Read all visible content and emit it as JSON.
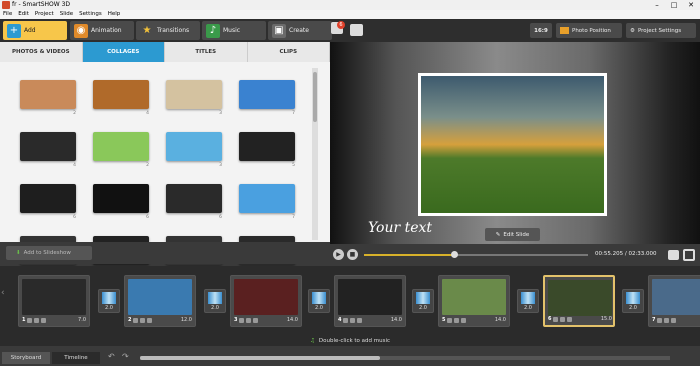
{
  "window": {
    "title": "fr - SmartSHOW 3D"
  },
  "menu": [
    "File",
    "Edit",
    "Project",
    "Slide",
    "Settings",
    "Help"
  ],
  "main_tabs": [
    {
      "label": "Add",
      "icon": "plus-icon"
    },
    {
      "label": "Animation",
      "icon": "animation-icon"
    },
    {
      "label": "Transitions",
      "icon": "star-icon"
    },
    {
      "label": "Music",
      "icon": "music-icon"
    },
    {
      "label": "Create",
      "icon": "film-icon"
    }
  ],
  "notification_count": "6",
  "toolbar": {
    "aspect": "16:9",
    "photo_position": "Photo Position",
    "project_settings": "Project Settings"
  },
  "sub_tabs": [
    "PHOTOS & VIDEOS",
    "COLLAGES",
    "TITLES",
    "CLIPS"
  ],
  "collages": [
    {
      "count": "2",
      "color": "#c98a5a"
    },
    {
      "count": "4",
      "color": "#b06a2a"
    },
    {
      "count": "3",
      "color": "#d4c2a0"
    },
    {
      "count": "7",
      "color": "#3a82d0"
    },
    {
      "count": "4",
      "color": "#2a2a2a"
    },
    {
      "count": "2",
      "color": "#8ac85a"
    },
    {
      "count": "3",
      "color": "#5ab0e0"
    },
    {
      "count": "5",
      "color": "#222222"
    },
    {
      "count": "6",
      "color": "#1e1e1e"
    },
    {
      "count": "6",
      "color": "#111111"
    },
    {
      "count": "6",
      "color": "#2a2a2a"
    },
    {
      "count": "7",
      "color": "#4aa0e0"
    },
    {
      "count": "",
      "color": "#333333"
    },
    {
      "count": "",
      "color": "#222222"
    },
    {
      "count": "",
      "color": "#333333"
    },
    {
      "count": "",
      "color": "#2a2a2a"
    }
  ],
  "add_to_slideshow": "Add to Slideshow",
  "preview": {
    "overlay_text": "Your text",
    "edit_slide": "Edit Slide"
  },
  "player": {
    "time": "00:55.205 / 02:33.000",
    "progress": 0.4
  },
  "slides": [
    {
      "num": "1",
      "duration": "7.0",
      "color": "#2a2a2a"
    },
    {
      "num": "2",
      "duration": "12.0",
      "color": "#3a7ab0"
    },
    {
      "num": "3",
      "duration": "14.0",
      "color": "#5a2020"
    },
    {
      "num": "4",
      "duration": "14.0",
      "color": "#222222"
    },
    {
      "num": "5",
      "duration": "14.0",
      "color": "#6a8a4a"
    },
    {
      "num": "6",
      "duration": "15.0",
      "color": "#3a4a2a"
    },
    {
      "num": "7",
      "duration": "",
      "color": "#4a6a8a"
    }
  ],
  "transitions": [
    "2.0",
    "2.0",
    "2.0",
    "2.0",
    "2.0",
    "2.0"
  ],
  "music_hint": "Double-click to add music",
  "bottom_tabs": [
    "Storyboard",
    "Timeline"
  ]
}
